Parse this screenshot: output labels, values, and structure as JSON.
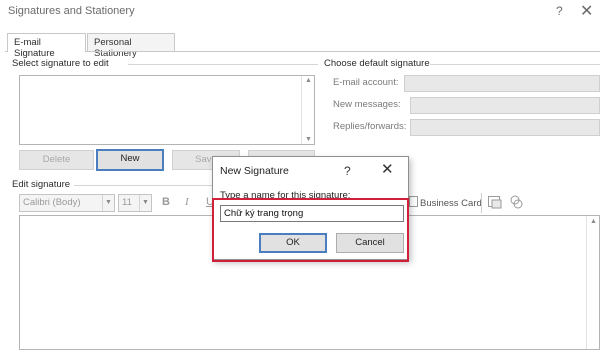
{
  "window": {
    "title": "Signatures and Stationery",
    "help_label": "?",
    "close_label": "✕"
  },
  "tabs": [
    {
      "label": "E-mail Signature"
    },
    {
      "label": "Personal Stationery"
    }
  ],
  "select_section": {
    "label": "Select signature to edit",
    "buttons": {
      "delete": "Delete",
      "new": "New",
      "save": "Save"
    }
  },
  "default_section": {
    "label": "Choose default signature",
    "email_account_label": "E-mail account:",
    "new_messages_label": "New messages:",
    "replies_label": "Replies/forwards:"
  },
  "edit_section": {
    "label": "Edit signature",
    "font_name": "Calibri (Body)",
    "font_size": "11",
    "bold": "B",
    "italic": "I",
    "underline": "U",
    "business_card": "Business Card"
  },
  "dialog": {
    "title": "New Signature",
    "help_label": "?",
    "close_label": "✕",
    "prompt": "Type a name for this signature:",
    "value": "Chữ ký trang trọng",
    "ok_label": "OK",
    "cancel_label": "Cancel"
  },
  "colors": {
    "highlight": "#d0203a",
    "focus": "#4a7ebf"
  }
}
